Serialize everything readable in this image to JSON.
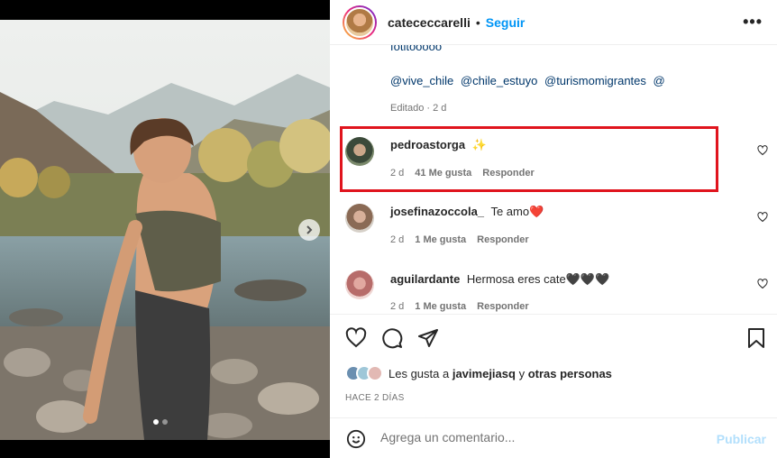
{
  "post": {
    "author": "catececcarelli",
    "separator": "•",
    "follow_label": "Seguir",
    "more_label": "•••",
    "caption_cut": "fotitooooo",
    "mentions": [
      "@vive_chile",
      "@chile_estuyo",
      "@turismomigrantes",
      "@"
    ],
    "edited_label": "Editado · 2 d"
  },
  "comments": [
    {
      "user": "pedroastorga",
      "text": "✨",
      "age": "2 d",
      "likes": "41 Me gusta",
      "reply": "Responder"
    },
    {
      "user": "josefinazoccola_",
      "text": "Te amo❤️",
      "age": "2 d",
      "likes": "1 Me gusta",
      "reply": "Responder"
    },
    {
      "user": "aguilardante",
      "text": "Hermosa eres cate🖤🖤🖤",
      "age": "2 d",
      "likes": "1 Me gusta",
      "reply": "Responder"
    }
  ],
  "likes": {
    "prefix": "Les gusta a",
    "user": "javimejiasq",
    "middle": "y",
    "suffix": "otras personas"
  },
  "timestamp": "HACE 2 DÍAS",
  "composer": {
    "placeholder": "Agrega un comentario...",
    "publish_label": "Publicar"
  },
  "colors": {
    "accent": "#0095f6",
    "highlight": "#e0141d",
    "publish_disabled": "#b2dffc"
  },
  "icons": [
    "chevron-right-icon",
    "more-icon",
    "heart-icon",
    "comment-icon",
    "share-icon",
    "bookmark-icon",
    "emoji-icon"
  ]
}
